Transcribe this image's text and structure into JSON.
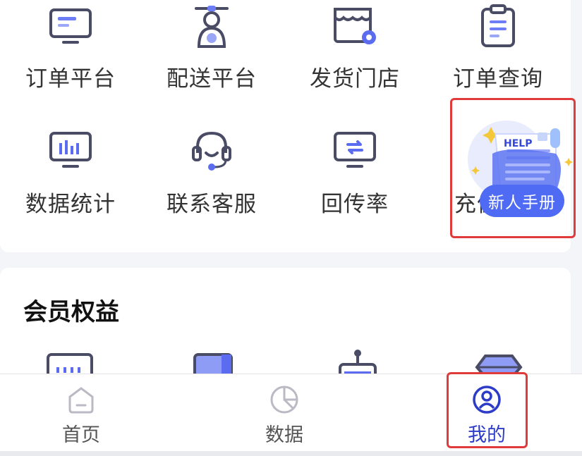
{
  "services": {
    "row1": [
      {
        "label": "订单平台",
        "icon": "monitor-icon"
      },
      {
        "label": "配送平台",
        "icon": "courier-icon"
      },
      {
        "label": "发货门店",
        "icon": "store-icon"
      },
      {
        "label": "订单查询",
        "icon": "clipboard-icon"
      }
    ],
    "row2": [
      {
        "label": "数据统计",
        "icon": "chart-monitor-icon"
      },
      {
        "label": "联系客服",
        "icon": "headset-icon"
      },
      {
        "label": "回传率",
        "icon": "sync-monitor-icon"
      },
      {
        "label": "充值中心",
        "icon": "wallet-icon"
      }
    ]
  },
  "promo": {
    "help_text": "HELP",
    "badge_label": "新人手册"
  },
  "benefits": {
    "title": "会员权益"
  },
  "tabbar": {
    "tabs": [
      {
        "label": "首页",
        "icon": "home-icon",
        "active": false
      },
      {
        "label": "数据",
        "icon": "pie-chart-icon",
        "active": false
      },
      {
        "label": "我的",
        "icon": "user-icon",
        "active": true
      }
    ]
  },
  "colors": {
    "accent": "#2c3cc8",
    "icon_stroke": "#4a4c66",
    "icon_blue": "#5b6cf0",
    "highlight": "#e03a3a"
  }
}
